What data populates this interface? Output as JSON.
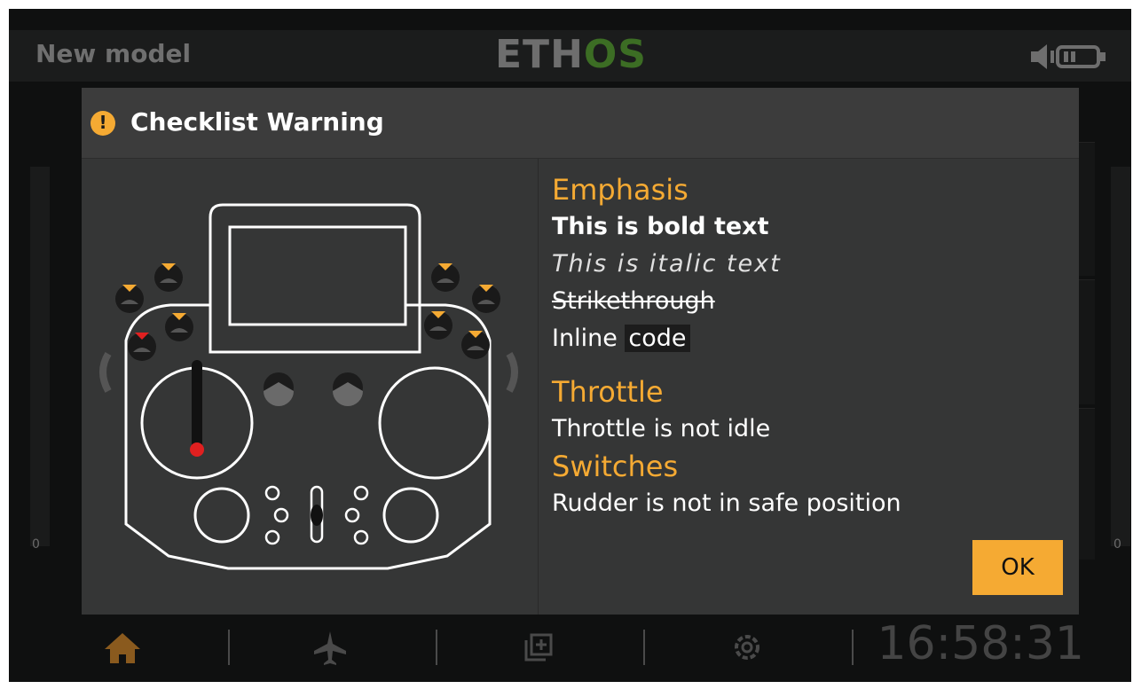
{
  "topbar": {
    "model_name": "New model",
    "logo_part1": "ETH",
    "logo_part2": "OS"
  },
  "background": {
    "left_zero": "0",
    "right_zero": "0"
  },
  "dialog": {
    "title": "Checklist Warning",
    "icon": "warning-icon",
    "sections": {
      "emphasis_heading": "Emphasis",
      "bold_text": "This is bold text",
      "italic_text": "This is italic text",
      "strike_text": "Strikethrough",
      "inline_prefix": "Inline",
      "inline_code": "code",
      "throttle_heading": "Throttle",
      "throttle_text": "Throttle is not idle",
      "switches_heading": "Switches",
      "switches_text": "Rudder is not in safe position"
    },
    "ok_label": "OK"
  },
  "nav": {
    "items": [
      "home-icon",
      "airplane-icon",
      "model-icon",
      "settings-icon"
    ],
    "clock": "16:58:31"
  },
  "colors": {
    "accent": "#f5aa33",
    "alert_red": "#e02020",
    "dialog_bg": "#353636"
  }
}
